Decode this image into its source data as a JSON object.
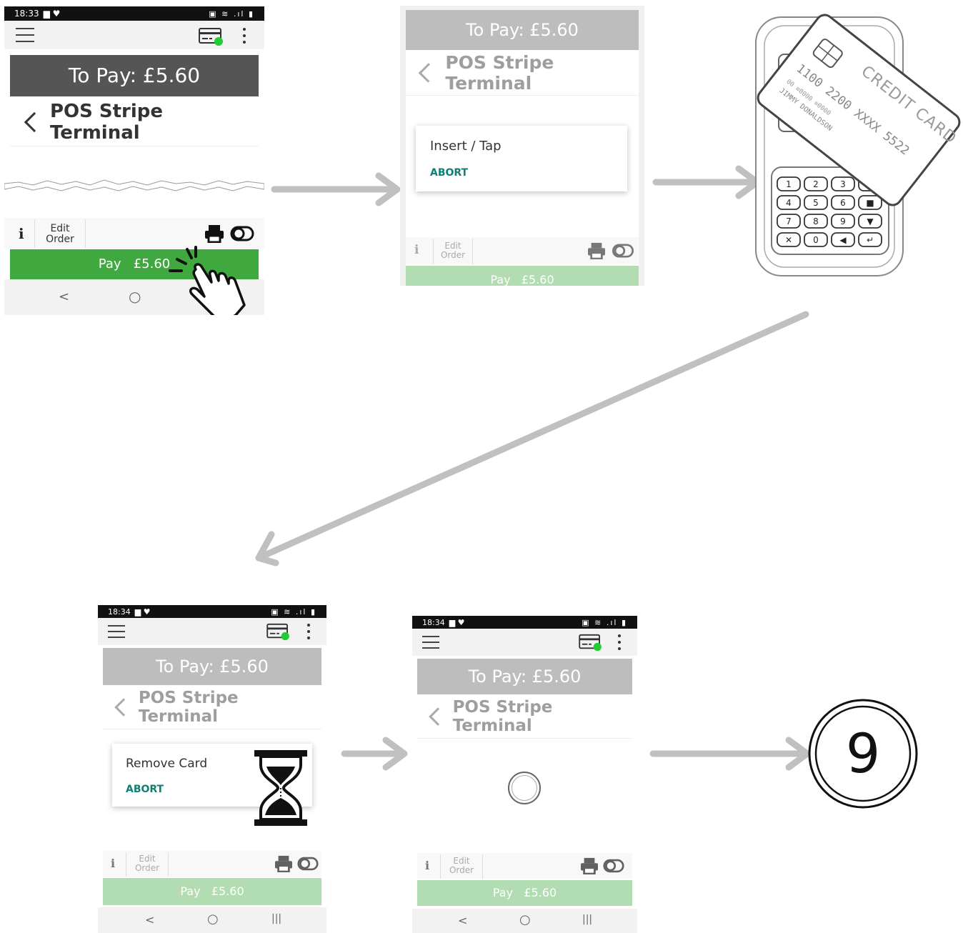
{
  "screen1": {
    "status_time": "18:33",
    "to_pay": "To Pay: £5.60",
    "title": "POS Stripe Terminal",
    "edit_order": [
      "Edit",
      "Order"
    ],
    "pay_label": "Pay",
    "pay_amount": "£5.60"
  },
  "screen2": {
    "to_pay": "To Pay: £5.60",
    "title": "POS Stripe Terminal",
    "dialog_message": "Insert / Tap",
    "abort": "ABORT",
    "edit_order": [
      "Edit",
      "Order"
    ],
    "pay_label": "Pay",
    "pay_amount": "£5.60"
  },
  "terminal": {
    "card_label": "CREDIT CARD",
    "card_number": "1100 2200 XXXX 5522",
    "card_valid": "00 ≡0000 ≡0000",
    "card_holder": "JIMMY DONALDSON",
    "keys": [
      "1",
      "2",
      "3",
      "▲",
      "4",
      "5",
      "6",
      "■",
      "7",
      "8",
      "9",
      "▼",
      "✕",
      "0",
      "◀",
      "↵"
    ]
  },
  "screen3": {
    "status_time": "18:34",
    "to_pay": "To Pay: £5.60",
    "title": "POS Stripe Terminal",
    "dialog_message": "Remove Card",
    "abort": "ABORT",
    "edit_order": [
      "Edit",
      "Order"
    ],
    "pay_label": "Pay",
    "pay_amount": "£5.60"
  },
  "screen4": {
    "status_time": "18:34",
    "to_pay": "To Pay: £5.60",
    "title": "POS Stripe Terminal",
    "edit_order": [
      "Edit",
      "Order"
    ],
    "pay_label": "Pay",
    "pay_amount": "£5.60"
  },
  "step_number": "9",
  "nav": {
    "back": "<",
    "home": "○",
    "recents": "|||"
  },
  "colors": {
    "topay_dark": "#555555",
    "topay_light": "#bdbdbd",
    "pay_green": "#3fa93f",
    "pay_green_light": "#b2dcb2",
    "abort_teal": "#0f7f74",
    "status_green": "#22cc33",
    "arrow_gray": "#c0c0c0"
  }
}
